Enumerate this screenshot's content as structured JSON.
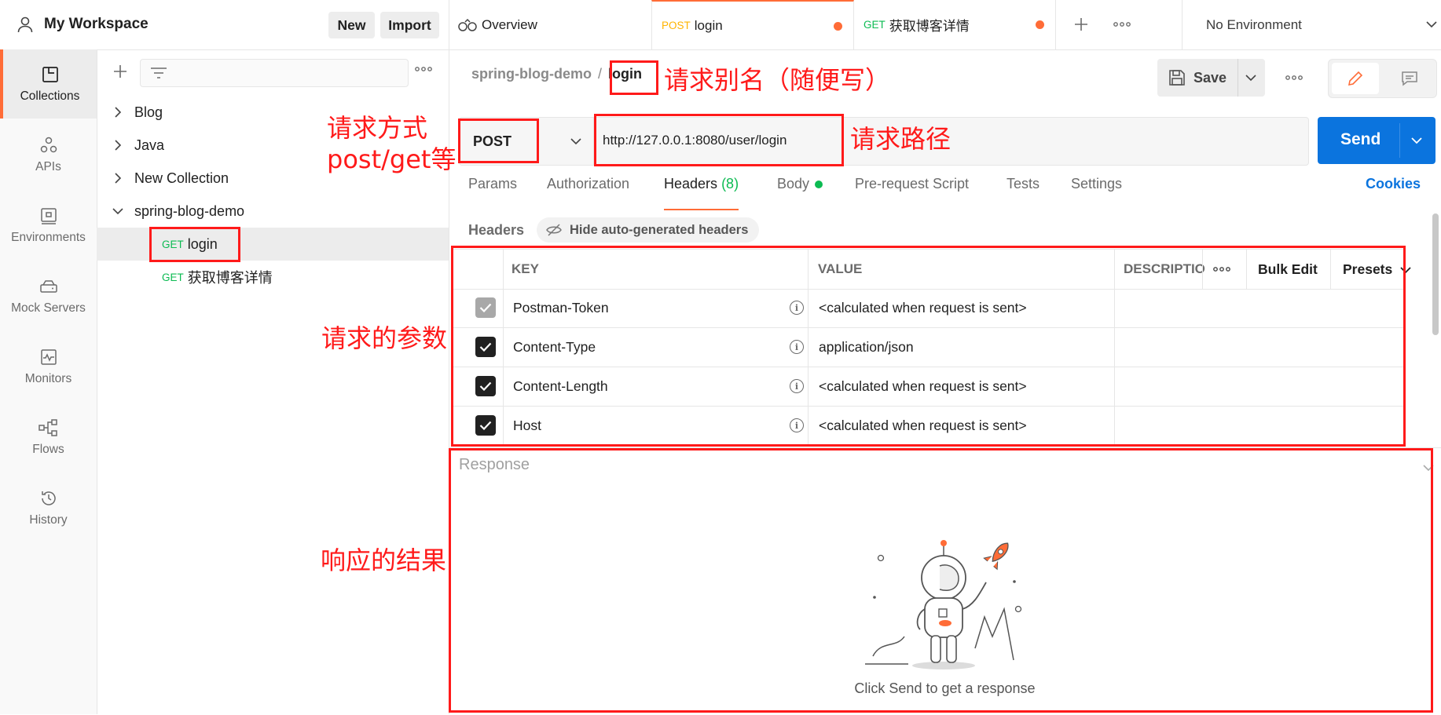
{
  "workspace": {
    "title": "My Workspace",
    "new_label": "New",
    "import_label": "Import"
  },
  "rail": [
    {
      "label": "Collections",
      "icon": "collections-icon"
    },
    {
      "label": "APIs",
      "icon": "apis-icon"
    },
    {
      "label": "Environments",
      "icon": "environments-icon"
    },
    {
      "label": "Mock Servers",
      "icon": "mock-servers-icon"
    },
    {
      "label": "Monitors",
      "icon": "monitors-icon"
    },
    {
      "label": "Flows",
      "icon": "flows-icon"
    },
    {
      "label": "History",
      "icon": "history-icon"
    }
  ],
  "tree": {
    "folders": [
      "Blog",
      "Java",
      "New Collection",
      "spring-blog-demo"
    ],
    "requests": [
      {
        "method": "GET",
        "name": "login"
      },
      {
        "method": "GET",
        "name": "获取博客详情"
      }
    ]
  },
  "tabs": [
    {
      "label": "Overview",
      "icon": "overview-icon"
    },
    {
      "method": "POST",
      "label": "login"
    },
    {
      "method": "GET",
      "label": "获取博客详情"
    }
  ],
  "environment": "No Environment",
  "breadcrumb": {
    "collection": "spring-blog-demo",
    "separator": "/",
    "request": "login"
  },
  "save_label": "Save",
  "request": {
    "method": "POST",
    "url": "http://127.0.0.1:8080/user/login",
    "send_label": "Send"
  },
  "subtabs": {
    "params": "Params",
    "authorization": "Authorization",
    "headers": "Headers",
    "headers_count": "(8)",
    "body": "Body",
    "prerequest": "Pre-request Script",
    "tests": "Tests",
    "settings": "Settings",
    "cookies": "Cookies"
  },
  "headers_section": {
    "title": "Headers",
    "hide_label": "Hide auto-generated headers"
  },
  "headers_table": {
    "columns": {
      "key": "KEY",
      "value": "VALUE",
      "description": "DESCRIPTIO",
      "bulk_edit": "Bulk Edit",
      "presets": "Presets"
    },
    "rows": [
      {
        "key": "Postman-Token",
        "value": "<calculated when request is sent>",
        "checked": true,
        "disabled": true
      },
      {
        "key": "Content-Type",
        "value": "application/json",
        "checked": true,
        "disabled": false
      },
      {
        "key": "Content-Length",
        "value": "<calculated when request is sent>",
        "checked": true,
        "disabled": false
      },
      {
        "key": "Host",
        "value": "<calculated when request is sent>",
        "checked": true,
        "disabled": false
      }
    ]
  },
  "response": {
    "title": "Response",
    "empty_text": "Click Send to get a response"
  },
  "annotations": {
    "alias": "请求别名（随便写）",
    "method_line1": "请求方式",
    "method_line2": "post/get等",
    "path": "请求路径",
    "params": "请求的参数",
    "result": "响应的结果"
  },
  "colors": {
    "accent": "#ff6c37",
    "send": "#0b74de",
    "get": "#0cbb52",
    "post": "#ffb400",
    "annotation": "#ff1a1a"
  }
}
